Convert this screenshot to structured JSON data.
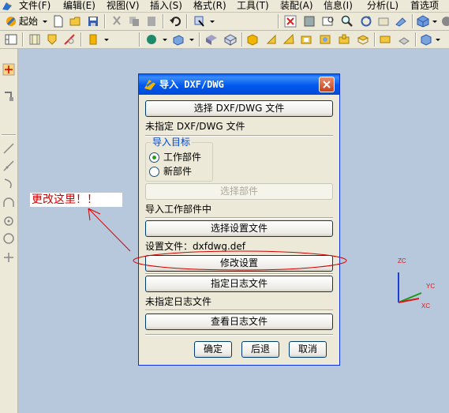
{
  "menu": {
    "items": [
      {
        "label": "文件(F)"
      },
      {
        "label": "编辑(E)"
      },
      {
        "label": "视图(V)"
      },
      {
        "label": "插入(S)"
      },
      {
        "label": "格式(R)"
      },
      {
        "label": "工具(T)"
      },
      {
        "label": "装配(A)"
      },
      {
        "label": "信息(I)"
      },
      {
        "label": "分析(L)"
      },
      {
        "label": "首选项"
      }
    ]
  },
  "toolbar": {
    "start_label": "起始"
  },
  "annotation": {
    "note": "更改这里！！",
    "color": "#d40000"
  },
  "dialog": {
    "title": "导入 DXF/DWG",
    "select_file_button": "选择 DXF/DWG 文件",
    "no_file_text": "未指定 DXF/DWG 文件",
    "import_target_label": "导入目标",
    "radio_work_part": "工作部件",
    "radio_new_part": "新部件",
    "selected_radio": "工作部件",
    "select_part_button": "选择部件",
    "import_into_text": "导入工作部件中",
    "select_settings_button": "选择设置文件",
    "settings_file_label": "设置文件：dxfdwg.def",
    "modify_settings_button": "修改设置",
    "specify_log_button": "指定日志文件",
    "no_log_text": "未指定日志文件",
    "view_log_button": "查看日志文件",
    "ok_button": "确定",
    "back_button": "后退",
    "cancel_button": "取消"
  },
  "triad": {
    "zc": "ZC",
    "yc": "YC",
    "xc": "XC",
    "colors": {
      "z": "#1a3fd4",
      "y": "#1a9a1a",
      "x": "#d41a1a"
    }
  }
}
